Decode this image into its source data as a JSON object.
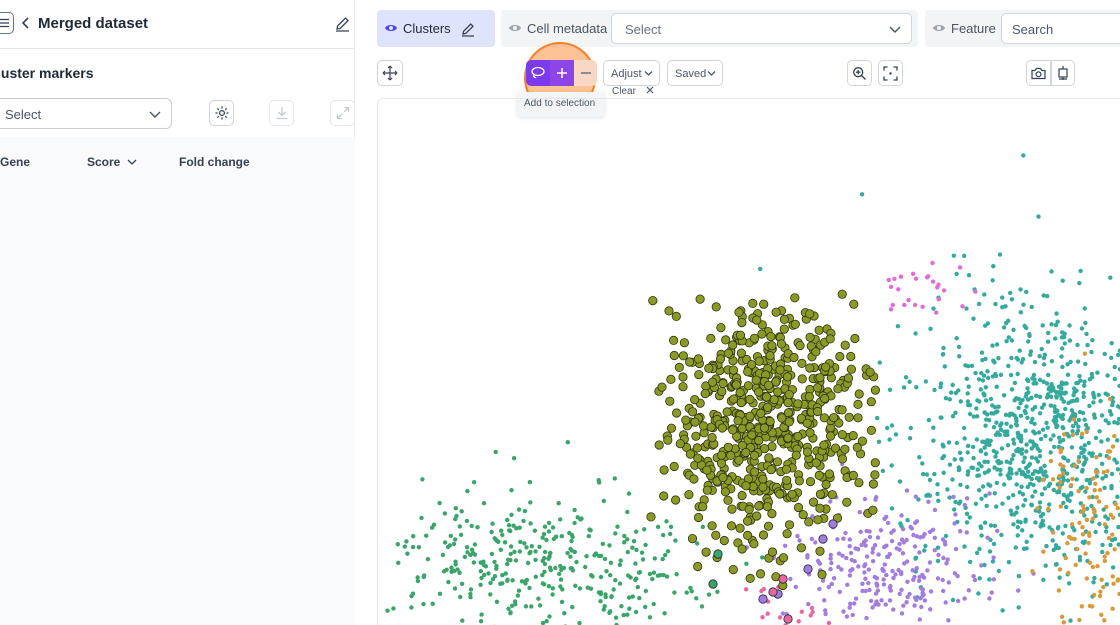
{
  "header": {
    "title": "Merged dataset"
  },
  "left_panel": {
    "section_title": "luster markers",
    "select": {
      "value": "Select"
    },
    "table": {
      "columns": [
        "Gene",
        "Score",
        "Fold change"
      ]
    }
  },
  "top_bar": {
    "clusters": {
      "label": "Clusters"
    },
    "cell_metadata": {
      "label": "Cell metadata",
      "select_value": "Select"
    },
    "feature": {
      "label": "Feature",
      "search_placeholder": "Search"
    }
  },
  "plot_toolbar": {
    "adjust_label": "Adjust",
    "saved_label": "Saved",
    "tooltip": "Add to selection",
    "clear_label": "Clear",
    "lasso_active_color": "#7c3aed"
  },
  "clusters": [
    {
      "color": "#8b9a27",
      "outlined": true
    },
    {
      "color": "#35a99c"
    },
    {
      "color": "#3aa46b"
    },
    {
      "color": "#a27de0"
    },
    {
      "color": "#e9679f"
    },
    {
      "color": "#d69a3c"
    },
    {
      "color": "#df6dd9"
    }
  ]
}
